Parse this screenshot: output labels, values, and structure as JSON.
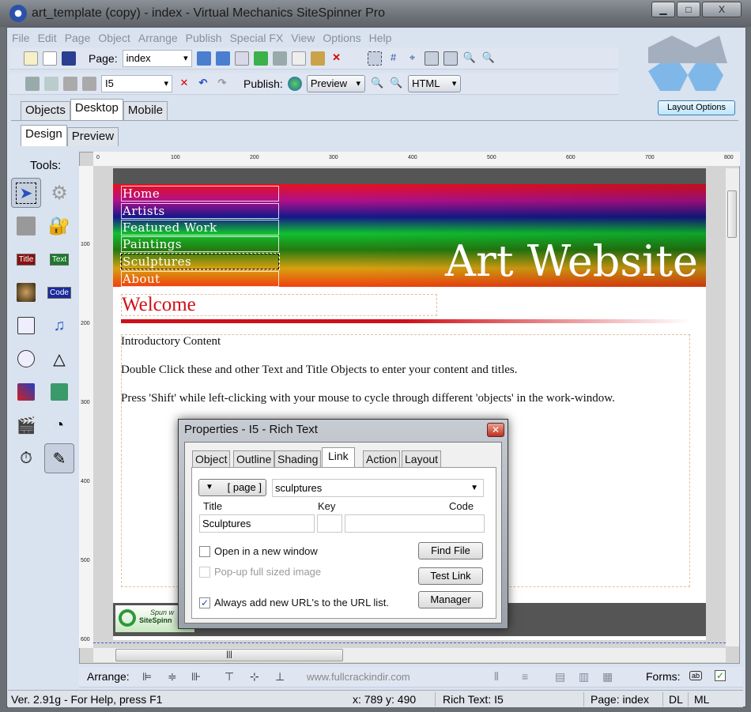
{
  "window": {
    "title": "art_template (copy) - index - Virtual Mechanics SiteSpinner Pro",
    "minimize": "▁",
    "maximize": "□",
    "close": "X"
  },
  "menu": [
    "File",
    "Edit",
    "Page",
    "Object",
    "Arrange",
    "Publish",
    "Special FX",
    "View",
    "Options",
    "Help"
  ],
  "toolbar1": {
    "page_label": "Page:",
    "page_value": "index"
  },
  "toolbar2": {
    "object_value": "I5",
    "publish_label": "Publish:",
    "preview_select": "Preview",
    "format_select": "HTML"
  },
  "tabs": {
    "objects": "Objects",
    "desktop": "Desktop",
    "mobile": "Mobile",
    "layout_options": "Layout Options"
  },
  "subtabs": {
    "design": "Design",
    "preview": "Preview"
  },
  "tools": {
    "label": "Tools:",
    "title_icon": "Title",
    "text_icon": "Text",
    "code_icon": "Code"
  },
  "ruler": {
    "top": [
      "0",
      "100",
      "200",
      "300",
      "400",
      "500",
      "600",
      "700",
      "800"
    ],
    "left": [
      "100",
      "200",
      "300",
      "400",
      "500",
      "600"
    ]
  },
  "site": {
    "nav": [
      "Home",
      "Artists",
      "Featured Work",
      "Paintings",
      "Sculptures",
      "About"
    ],
    "heading": "Art Website",
    "welcome": "Welcome",
    "content": [
      "Introductory Content",
      "Double Click these and other Text and Title Objects to enter your content and titles.",
      "Press 'Shift' while left-clicking with your mouse to cycle through different 'objects' in the work-window."
    ],
    "badge_line1": "Spun w",
    "badge_line2": "SiteSpinn"
  },
  "dialog": {
    "title": "Properties  -  I5  -  Rich Text",
    "tabs": [
      "Object",
      "Outline",
      "Shading",
      "Link",
      "Action",
      "Layout"
    ],
    "active_tab": "Link",
    "link_type": "[ page ]",
    "link_target": "sculptures",
    "title_label": "Title",
    "key_label": "Key",
    "code_label": "Code",
    "title_value": "Sculptures",
    "key_value": "",
    "code_value": "",
    "open_new_window": {
      "label": "Open in a new window",
      "checked": false
    },
    "popup_image": {
      "label": "Pop-up full sized image",
      "checked": false,
      "disabled": true
    },
    "always_add_url": {
      "label": "Always add new URL's to the URL list.",
      "checked": true
    },
    "find_file": "Find File",
    "test_link": "Test Link",
    "manager": "Manager"
  },
  "arrange": {
    "label": "Arrange:",
    "forms_label": "Forms:",
    "watermark": "www.fullcrackindir.com"
  },
  "status": {
    "help": "Ver. 2.91g - For Help, press F1",
    "coords": "x: 789  y: 490",
    "object": "Rich Text: I5",
    "page": "Page:  index",
    "dl": "DL",
    "ml": "ML"
  }
}
